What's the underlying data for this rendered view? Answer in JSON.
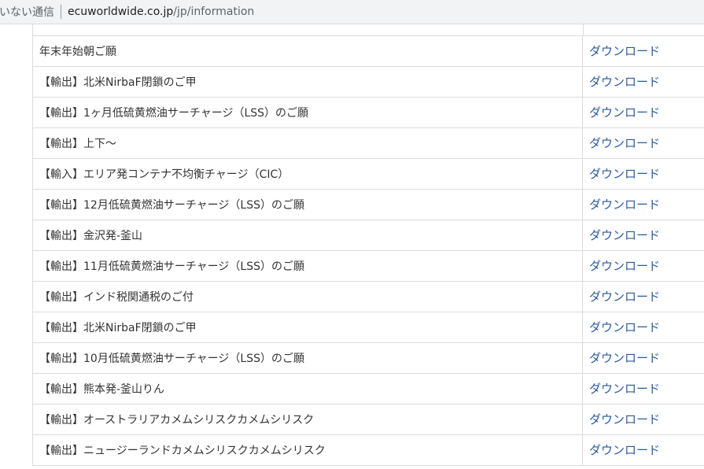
{
  "addressbar": {
    "security_label": "いない通信",
    "host": "ecuworldwide.co.jp",
    "path": "/jp/information"
  },
  "table": {
    "rows": [
      {
        "title": "年末年始朝ご願",
        "link": "ダウンロード"
      },
      {
        "title": "【輸出】北米NirbaF閉鎖のご甲",
        "link": "ダウンロード"
      },
      {
        "title": "【輸出】1ヶ月低硫黄燃油サーチャージ（LSS）のご願",
        "link": "ダウンロード"
      },
      {
        "title": "【輸出】上下～",
        "link": "ダウンロード"
      },
      {
        "title": "【輸入】エリア発コンテナ不均衡チャージ（CIC）",
        "link": "ダウンロード"
      },
      {
        "title": "【輸出】12月低硫黄燃油サーチャージ（LSS）のご願",
        "link": "ダウンロード"
      },
      {
        "title": "【輸出】金沢発-釜山",
        "link": "ダウンロード"
      },
      {
        "title": "【輸出】11月低硫黄燃油サーチャージ（LSS）のご願",
        "link": "ダウンロード"
      },
      {
        "title": "【輸出】インド税関通税のご付",
        "link": "ダウンロード"
      },
      {
        "title": "【輸出】北米NirbaF閉鎖のご甲",
        "link": "ダウンロード"
      },
      {
        "title": "【輸出】10月低硫黄燃油サーチャージ（LSS）のご願",
        "link": "ダウンロード"
      },
      {
        "title": "【輸出】熊本発-釜山りん",
        "link": "ダウンロード"
      },
      {
        "title": "【輸出】オーストラリアカメムシリスクカメムシリスク",
        "link": "ダウンロード"
      },
      {
        "title": "【輸出】ニュージーランドカメムシリスクカメムシリスク",
        "link": "ダウンロード"
      }
    ]
  },
  "colors": {
    "link": "#2a5a9c",
    "text": "#333333",
    "border": "#dcdcdc",
    "addressbar_bg": "#f1f3f4"
  }
}
